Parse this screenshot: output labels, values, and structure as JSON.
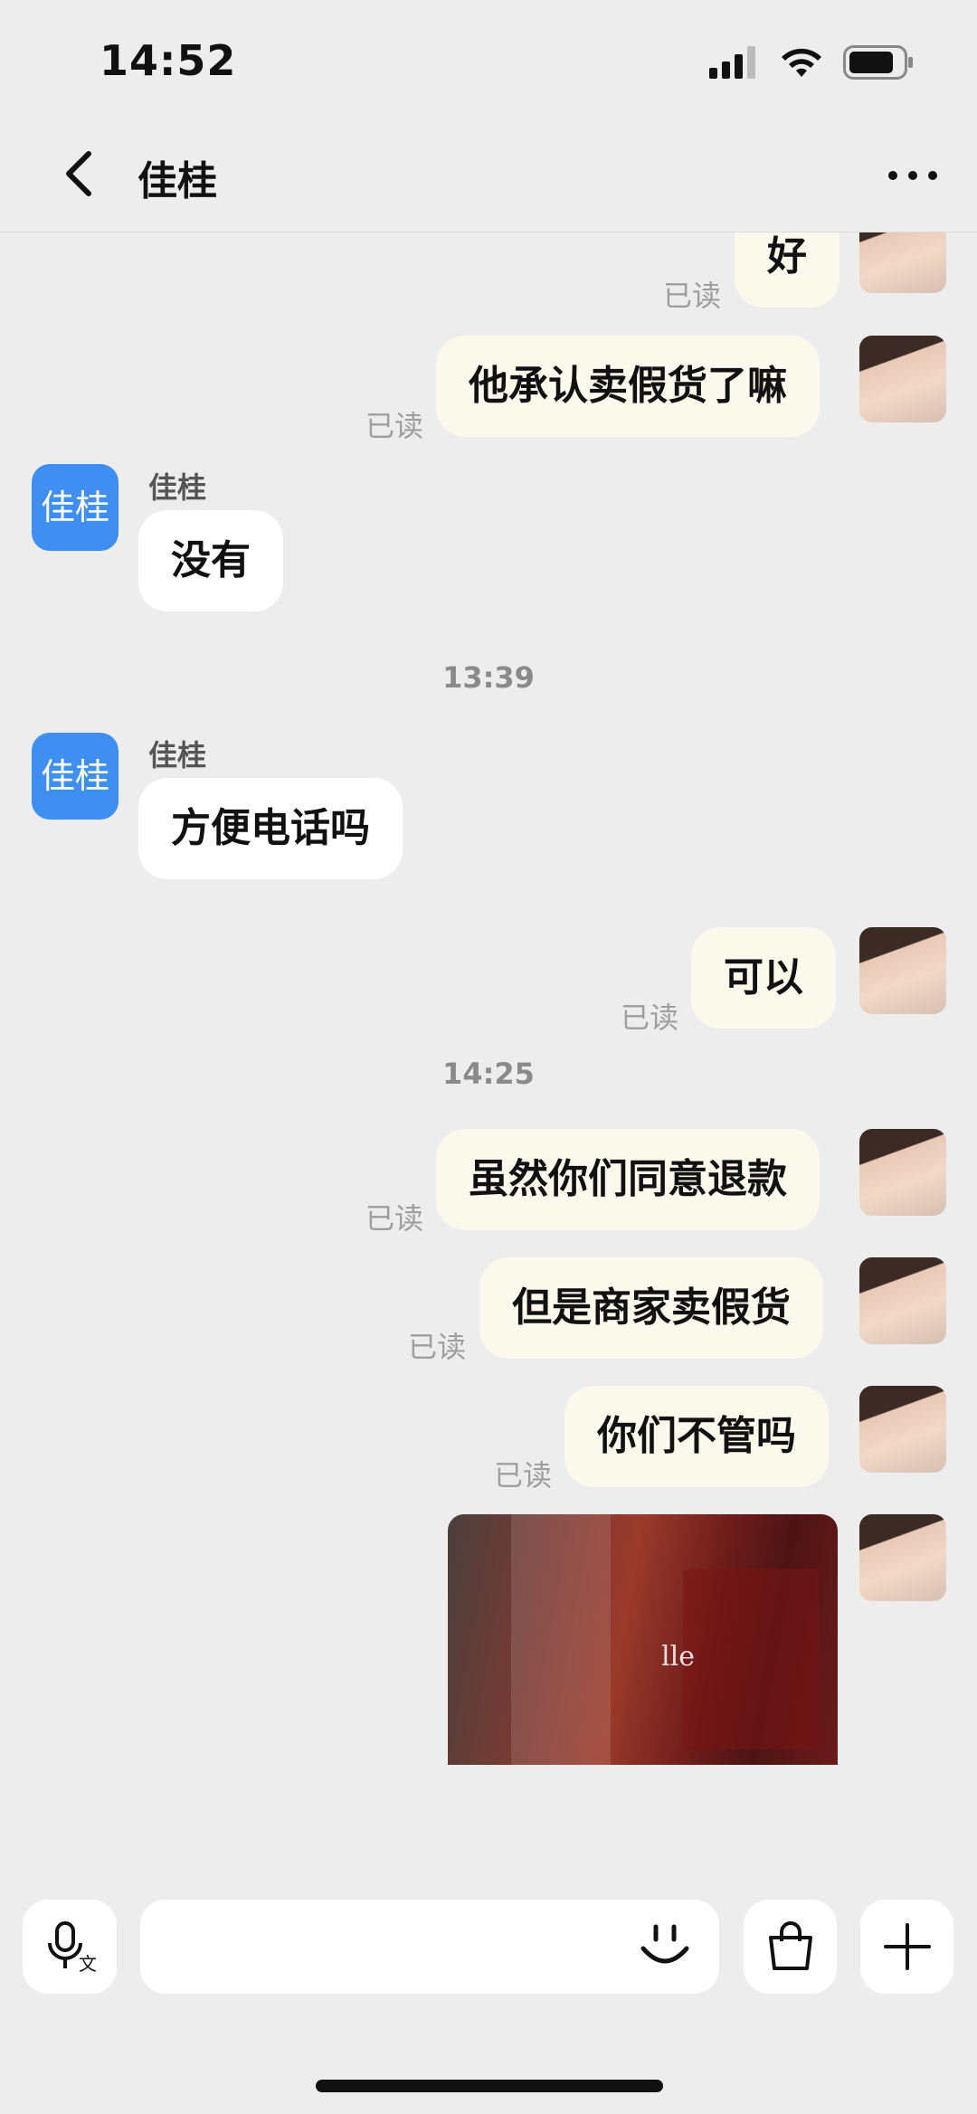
{
  "status_bar": {
    "time": "14:52"
  },
  "nav": {
    "title": "佳桂"
  },
  "contact": {
    "name": "佳桂",
    "avatar_text": "佳桂"
  },
  "read_label": "已读",
  "messages": [
    {
      "from": "me",
      "text": "好",
      "status": "已读"
    },
    {
      "from": "me",
      "text": "他承认卖假货了嘛",
      "status": "已读"
    },
    {
      "from": "other",
      "sender": "佳桂",
      "text": "没有"
    },
    {
      "timestamp": "13:39"
    },
    {
      "from": "other",
      "sender": "佳桂",
      "text": "方便电话吗"
    },
    {
      "from": "me",
      "text": "可以",
      "status": "已读"
    },
    {
      "timestamp": "14:25"
    },
    {
      "from": "me",
      "text": "虽然你们同意退款",
      "status": "已读"
    },
    {
      "from": "me",
      "text": "但是商家卖假货",
      "status": "已读"
    },
    {
      "from": "me",
      "text": "你们不管吗",
      "status": "已读"
    },
    {
      "from": "me",
      "type": "image",
      "image_text": "lle"
    }
  ],
  "icons": {
    "back": "chevron-left-icon",
    "more": "more-dots-icon",
    "voice": "microphone-icon",
    "emoji": "emoji-icon",
    "shop": "shopping-bag-icon",
    "add": "plus-icon"
  },
  "colors": {
    "background": "#ededed",
    "my_bubble": "#fbf8ec",
    "their_bubble": "#ffffff",
    "avatar_blue": "#3f8ff2"
  }
}
